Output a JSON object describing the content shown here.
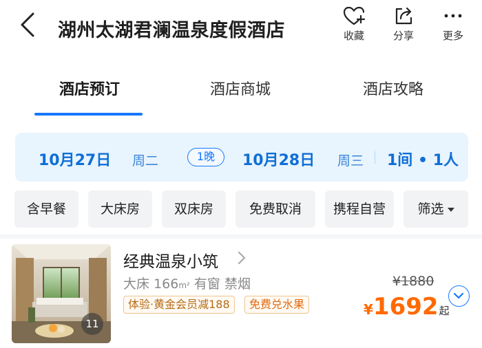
{
  "header": {
    "title": "湖州太湖君澜温泉度假酒店",
    "actions": [
      {
        "label": "收藏",
        "icon": "heart-plus-icon"
      },
      {
        "label": "分享",
        "icon": "share-icon"
      },
      {
        "label": "更多",
        "icon": "more-dots-icon"
      }
    ]
  },
  "tabs": [
    {
      "label": "酒店预订",
      "active": true
    },
    {
      "label": "酒店商城",
      "active": false
    },
    {
      "label": "酒店攻略",
      "active": false
    }
  ],
  "date_bar": {
    "checkin_date": "10月27日",
    "checkin_weekday": "周二",
    "nights": "1晚",
    "checkout_date": "10月28日",
    "checkout_weekday": "周三",
    "guests": "1间 • 1人"
  },
  "filters": [
    "含早餐",
    "大床房",
    "双床房",
    "免费取消",
    "携程自营",
    "筛选"
  ],
  "room": {
    "name": "经典温泉小筑",
    "bed": "大床",
    "area": "166",
    "area_unit": "m²",
    "window": "有窗",
    "smoking": "禁烟",
    "image_count": "11",
    "tags": [
      "体验·黄金会员减188",
      "免费兑水果"
    ],
    "original_price": "¥1880",
    "currency": "¥",
    "price": "1692",
    "price_suffix": "起"
  },
  "colors": {
    "accent": "#1677ff",
    "date_text": "#0f6fd6",
    "date_bg": "#e8f4fe",
    "price": "#ff6a00",
    "tag_border": "#f0c48e"
  }
}
